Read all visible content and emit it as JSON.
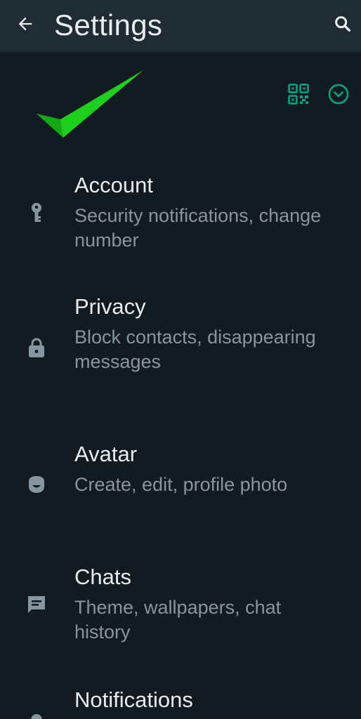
{
  "app_bar": {
    "title": "Settings",
    "back_icon": "arrow-left-icon",
    "search_icon": "search-icon"
  },
  "profile": {
    "qr_icon": "qr-code-icon",
    "expand_icon": "chevron-down-circle-icon",
    "annotation_icon": "green-checkmark-icon"
  },
  "colors": {
    "background": "#111b21",
    "app_bar": "#1f2c34",
    "accent": "#00a884",
    "title_text": "#e9edef",
    "subtitle_text": "#8696a0",
    "checkmark": "#1ed01e"
  },
  "settings": [
    {
      "title": "Account",
      "subtitle": "Security notifications, change number",
      "icon": "key-icon"
    },
    {
      "title": "Privacy",
      "subtitle": "Block contacts, disappearing messages",
      "icon": "lock-icon"
    },
    {
      "title": "Avatar",
      "subtitle": "Create, edit, profile photo",
      "icon": "avatar-face-icon"
    },
    {
      "title": "Chats",
      "subtitle": "Theme, wallpapers, chat history",
      "icon": "chat-icon"
    },
    {
      "title": "Notifications",
      "subtitle": "",
      "icon": "bell-icon"
    }
  ]
}
